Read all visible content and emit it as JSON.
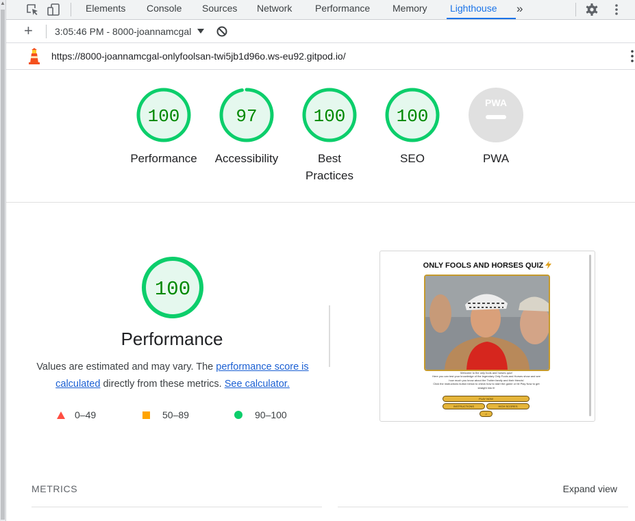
{
  "devtools": {
    "tabs": [
      {
        "label": "Elements"
      },
      {
        "label": "Console"
      },
      {
        "label": "Sources"
      },
      {
        "label": "Network"
      },
      {
        "label": "Performance"
      },
      {
        "label": "Memory"
      },
      {
        "label": "Lighthouse",
        "active": true
      }
    ],
    "more_tabs_icon": "chevron-double-right-icon",
    "accent_color": "#1a73e8"
  },
  "lighthouse_toolbar": {
    "add_icon": "plus-icon",
    "report_label": "3:05:46 PM - 8000-joannamcgal",
    "clear_icon": "block-icon"
  },
  "report": {
    "url": "https://8000-joannamcgal-onlyfoolsan-twi5jb1d96o.ws-eu92.gitpod.io/",
    "categories": [
      {
        "label": "Performance",
        "score": "100",
        "value": 100
      },
      {
        "label": "Accessibility",
        "score": "97",
        "value": 97
      },
      {
        "label": "Best Practices",
        "score": "100",
        "value": 100
      },
      {
        "label": "SEO",
        "score": "100",
        "value": 100
      },
      {
        "label": "PWA",
        "score": "",
        "value": null
      }
    ],
    "pwa_badge_text": "PWA",
    "score_color_pass": "#0cce6b",
    "score_text_color": "#008800"
  },
  "performance": {
    "score": "100",
    "title": "Performance",
    "desc_before": "Values are estimated and may vary. The ",
    "desc_link1": "performance score is calculated",
    "desc_mid": " directly from these metrics. ",
    "desc_link2": "See calculator.",
    "legend": [
      {
        "range": "0–49",
        "color": "#ff4e42",
        "shape": "triangle"
      },
      {
        "range": "50–89",
        "color": "#ffa400",
        "shape": "square"
      },
      {
        "range": "90–100",
        "color": "#0cce6b",
        "shape": "circle"
      }
    ]
  },
  "screenshot": {
    "title": "ONLY FOOLS AND HORSES QUIZ",
    "intro_lines": [
      "Welcome to the only fools and horses quiz!",
      "Here you can test your knowledge of the legendary Only Fools and Horses show and see",
      "how much you know about the Trotter family and their friends!",
      "Click the instructions button below to check how to start the game or hit Play Now to get",
      "straight into it!"
    ],
    "buttons": [
      "PLAY NOW",
      "INSTRUCTIONS",
      "HIGH SCORES"
    ]
  },
  "metrics": {
    "label": "METRICS",
    "expand_label": "Expand view"
  }
}
